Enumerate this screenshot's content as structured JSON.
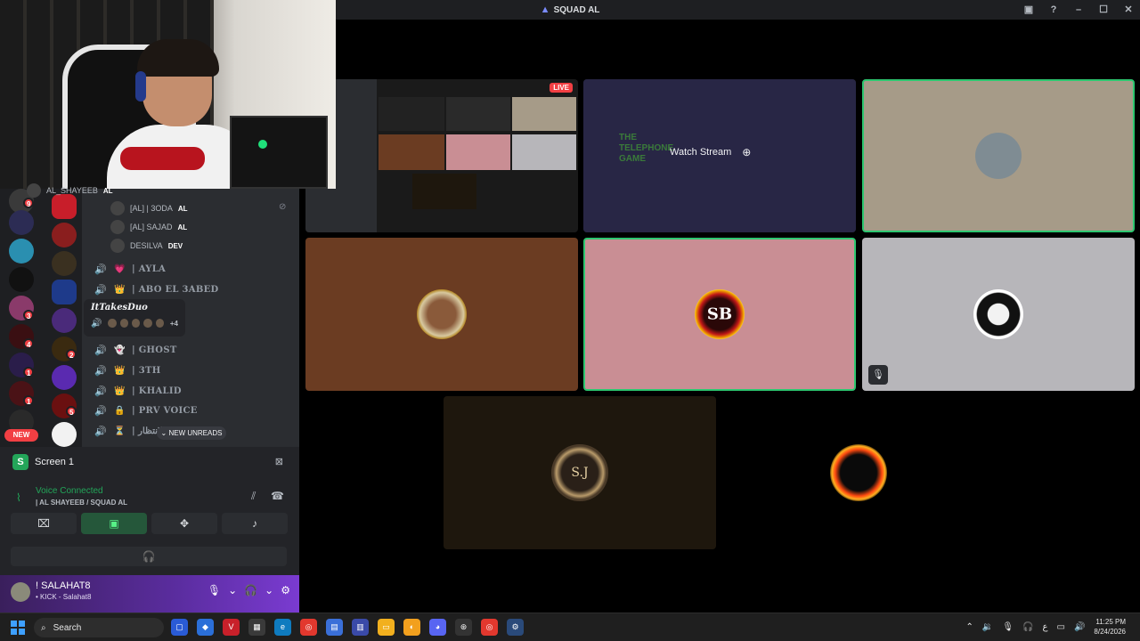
{
  "window": {
    "title": "SQUAD AL"
  },
  "servers": [
    {
      "badge": "9"
    },
    {
      "badge": ""
    },
    {
      "badge": ""
    },
    {
      "badge": ""
    },
    {
      "badge": "3"
    },
    {
      "badge": "4"
    },
    {
      "badge": "1"
    },
    {
      "badge": "1"
    },
    {
      "badge": ""
    }
  ],
  "servers2": [
    {
      "badge": ""
    },
    {
      "badge": ""
    },
    {
      "badge": ""
    },
    {
      "badge": ""
    },
    {
      "badge": ""
    },
    {
      "badge": "2"
    },
    {
      "badge": ""
    },
    {
      "badge": "5"
    },
    {
      "badge": ""
    }
  ],
  "new_label": "NEW",
  "channel_users": [
    {
      "name": "AL_SHAYEEB",
      "tag": "AL"
    },
    {
      "name": "[AL] | 3ODA",
      "tag": "AL"
    },
    {
      "name": "[AL] SAJAD",
      "tag": "AL"
    },
    {
      "name": "DESILVA",
      "tag": "DEV"
    }
  ],
  "voice_channels": [
    {
      "emoji": "💗",
      "name": "| AYLA"
    },
    {
      "emoji": "👑",
      "name": "| ABO EL 3ABED"
    },
    {
      "emoji": "👻",
      "name": "| GHOST"
    },
    {
      "emoji": "👑",
      "name": "| 3TH"
    },
    {
      "emoji": "👑",
      "name": "| KHALID"
    },
    {
      "emoji": "🔒",
      "name": "| PRV VOICE"
    },
    {
      "emoji": "⏳",
      "name": "| الانتظار"
    }
  ],
  "tooltip": {
    "name": "ItTakesDuo",
    "more": "+4"
  },
  "new_unreads": "NEW UNREADS",
  "screen_panel": {
    "title": "Screen 1",
    "voice_status": "Voice Connected",
    "voice_channel": "| AL SHAYEEB / SQUAD AL"
  },
  "user": {
    "name": "! SALAHAT8",
    "status": "• KICK - Salahat8"
  },
  "stream": {
    "live_label": "LIVE",
    "watch_label": "Watch Stream",
    "game_text": "THE TELEPHONE GAME",
    "tile_pink_text": "SB",
    "tile_dark_text": "S.J"
  },
  "taskbar": {
    "search": "Search",
    "time": "11:25 PM",
    "date": "8/24/2026",
    "lang": "ع"
  },
  "colors": {
    "accent_green": "#23a559",
    "live_red": "#f23f43",
    "speaking_border": "#2dc770"
  }
}
